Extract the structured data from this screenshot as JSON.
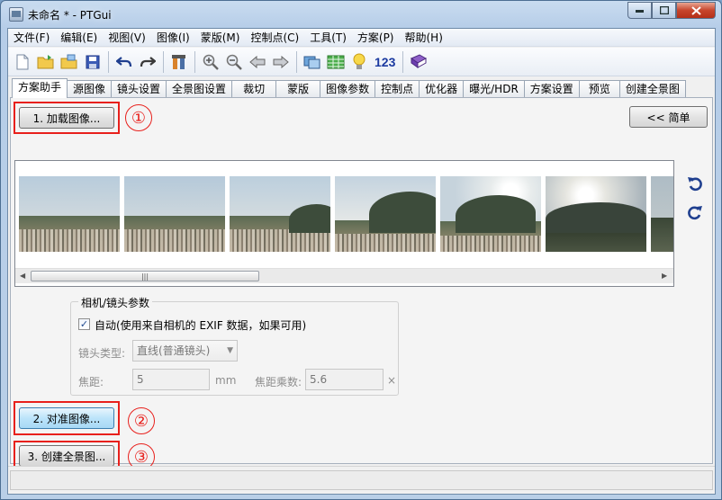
{
  "window": {
    "title": "未命名 * - PTGui"
  },
  "menu": [
    "文件(F)",
    "编辑(E)",
    "视图(V)",
    "图像(I)",
    "蒙版(M)",
    "控制点(C)",
    "工具(T)",
    "方案(P)",
    "帮助(H)"
  ],
  "toolbar": {
    "counter_label": "123"
  },
  "tabs": [
    "方案助手",
    "源图像",
    "镜头设置",
    "全景图设置",
    "裁切",
    "蒙版",
    "图像参数",
    "控制点",
    "优化器",
    "曝光/HDR",
    "方案设置",
    "预览",
    "创建全景图"
  ],
  "assistant": {
    "load_button": "1. 加载图像...",
    "simple_button": "<< 简单",
    "align_button": "2. 对准图像...",
    "create_button": "3. 创建全景图...",
    "markers": [
      "①",
      "②",
      "③"
    ],
    "scroll_grip": "|||"
  },
  "lens": {
    "group_title": "相机/镜头参数",
    "auto_checked": true,
    "auto_label": "自动(使用来自相机的 EXIF 数据，如果可用)",
    "lens_type_label": "镜头类型:",
    "lens_type_value": "直线(普通镜头)",
    "focal_label": "焦距:",
    "focal_value": "5",
    "focal_unit": "mm",
    "crop_label": "焦距乘数:",
    "crop_value": "5.6",
    "crop_unit": "×"
  },
  "colors": {
    "highlight": "#e8201c",
    "titlebar": "#b9cfe7"
  }
}
